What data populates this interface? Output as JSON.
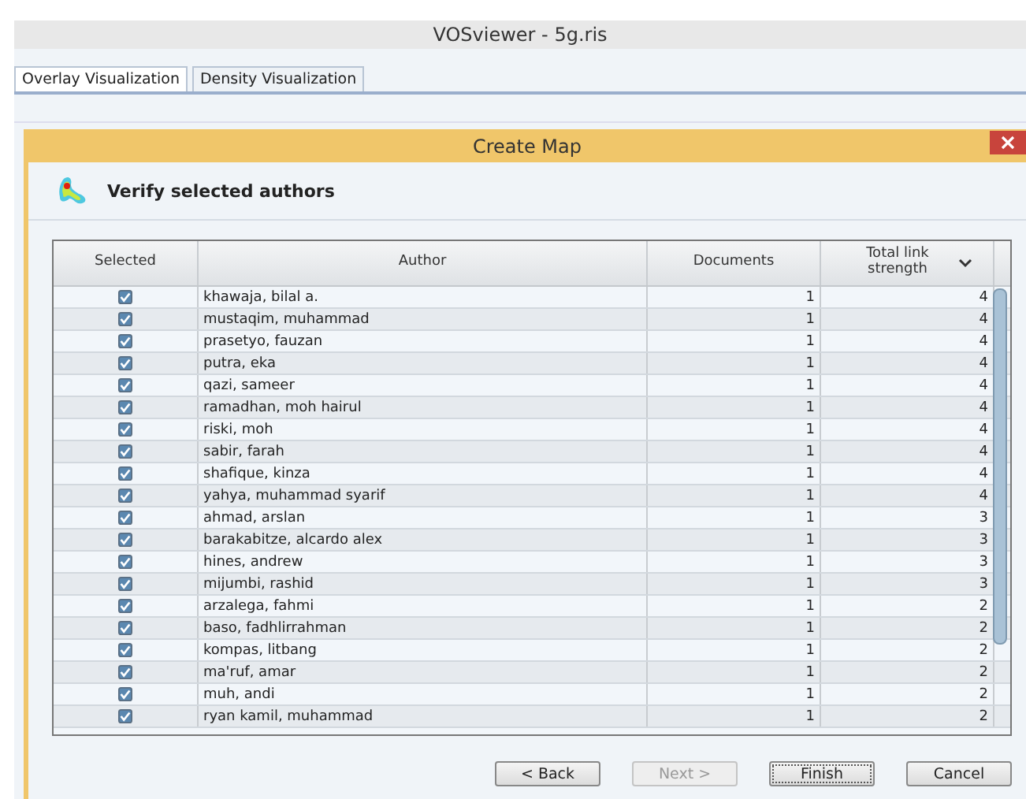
{
  "window": {
    "title": "VOSviewer - 5g.ris"
  },
  "tabs": [
    {
      "label": "Overlay Visualization",
      "selected": true
    },
    {
      "label": "Density Visualization",
      "selected": false
    }
  ],
  "dialog": {
    "title": "Create Map",
    "heading": "Verify selected authors"
  },
  "table": {
    "columns": [
      "Selected",
      "Author",
      "Documents",
      "Total link strength"
    ],
    "rows": [
      {
        "checked": true,
        "author": "khawaja, bilal a.",
        "documents": "1",
        "strength": "4"
      },
      {
        "checked": true,
        "author": "mustaqim, muhammad",
        "documents": "1",
        "strength": "4"
      },
      {
        "checked": true,
        "author": "prasetyo, fauzan",
        "documents": "1",
        "strength": "4"
      },
      {
        "checked": true,
        "author": "putra, eka",
        "documents": "1",
        "strength": "4"
      },
      {
        "checked": true,
        "author": "qazi, sameer",
        "documents": "1",
        "strength": "4"
      },
      {
        "checked": true,
        "author": "ramadhan, moh hairul",
        "documents": "1",
        "strength": "4"
      },
      {
        "checked": true,
        "author": "riski, moh",
        "documents": "1",
        "strength": "4"
      },
      {
        "checked": true,
        "author": "sabir, farah",
        "documents": "1",
        "strength": "4"
      },
      {
        "checked": true,
        "author": "shafique, kinza",
        "documents": "1",
        "strength": "4"
      },
      {
        "checked": true,
        "author": "yahya, muhammad syarif",
        "documents": "1",
        "strength": "4"
      },
      {
        "checked": true,
        "author": "ahmad, arslan",
        "documents": "1",
        "strength": "3"
      },
      {
        "checked": true,
        "author": "barakabitze, alcardo alex",
        "documents": "1",
        "strength": "3"
      },
      {
        "checked": true,
        "author": "hines, andrew",
        "documents": "1",
        "strength": "3"
      },
      {
        "checked": true,
        "author": "mijumbi, rashid",
        "documents": "1",
        "strength": "3"
      },
      {
        "checked": true,
        "author": "arzalega, fahmi",
        "documents": "1",
        "strength": "2"
      },
      {
        "checked": true,
        "author": "baso, fadhlirrahman",
        "documents": "1",
        "strength": "2"
      },
      {
        "checked": true,
        "author": "kompas, litbang",
        "documents": "1",
        "strength": "2"
      },
      {
        "checked": true,
        "author": "ma'ruf, amar",
        "documents": "1",
        "strength": "2"
      },
      {
        "checked": true,
        "author": "muh, andi",
        "documents": "1",
        "strength": "2"
      },
      {
        "checked": true,
        "author": "ryan kamil, muhammad",
        "documents": "1",
        "strength": "2"
      }
    ]
  },
  "buttons": [
    {
      "label": "< Back",
      "disabled": false,
      "focused": false
    },
    {
      "label": "Next >",
      "disabled": true,
      "focused": false
    },
    {
      "label": "Finish",
      "disabled": false,
      "focused": true
    },
    {
      "label": "Cancel",
      "disabled": false,
      "focused": false
    }
  ]
}
